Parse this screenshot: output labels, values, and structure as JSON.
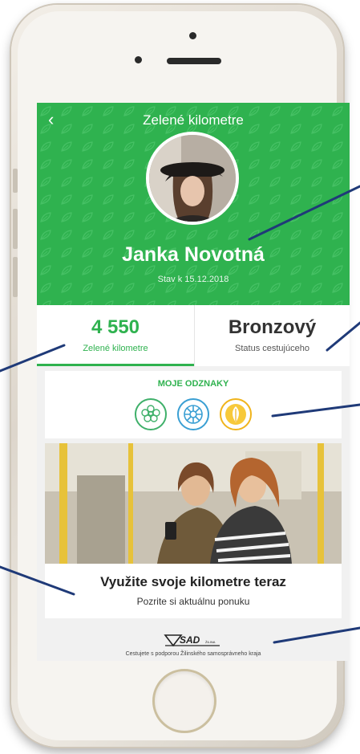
{
  "app": {
    "title": "Zelené kilometre",
    "back_icon": "chevron-left-icon"
  },
  "profile": {
    "name": "Janka Novotná",
    "state_date": "Stav k 15.12.2018"
  },
  "stats": {
    "kilometers_value": "4 550",
    "kilometers_label": "Zelené kilometre",
    "status_value": "Bronzový",
    "status_label": "Status cestujúceho"
  },
  "badges": {
    "title": "MOJE ODZNAKY",
    "items": [
      {
        "icon": "flower-icon",
        "color": "#3fb06a"
      },
      {
        "icon": "wheel-icon",
        "color": "#3a9fd3"
      },
      {
        "icon": "leaf-icon",
        "color": "#f0b41c"
      }
    ]
  },
  "promo": {
    "title": "Využite svoje kilometre teraz",
    "subtitle": "Pozrite si aktuálnu ponuku"
  },
  "footer": {
    "logo_text": "SAD",
    "logo_subtext": "ŽILINA",
    "text": "Cestujete s podporou Žilinského samosprávneho kraja"
  },
  "colors": {
    "brand_green": "#2fb24f",
    "callout_line": "#1f3a78"
  }
}
